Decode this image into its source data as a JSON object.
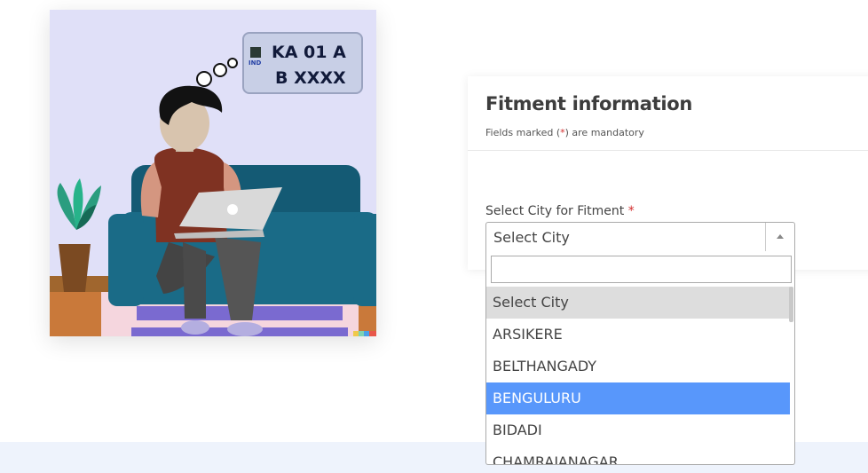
{
  "illustration": {
    "plate_line1": "KA 01 A",
    "plate_line2": "B XXXX",
    "plate_country": "IND"
  },
  "card": {
    "title": "Fitment information",
    "subtitle_prefix": "Fields marked (",
    "subtitle_star": "*",
    "subtitle_suffix": ") are mandatory"
  },
  "city_field": {
    "label": "Select City for Fitment",
    "required_mark": "*",
    "value": "Select City",
    "search_value": "",
    "options": [
      "Select City",
      "ARSIKERE",
      "BELTHANGADY",
      "BENGULURU",
      "BIDADI",
      "CHAMRAJANAGAR"
    ],
    "selected_option": "Select City",
    "highlighted_option": "BENGULURU"
  },
  "colors": {
    "highlight": "#5897fb",
    "selected_bg": "#dddddd",
    "required": "#d32f2f",
    "illustration_bg": "#e0e0f8"
  }
}
